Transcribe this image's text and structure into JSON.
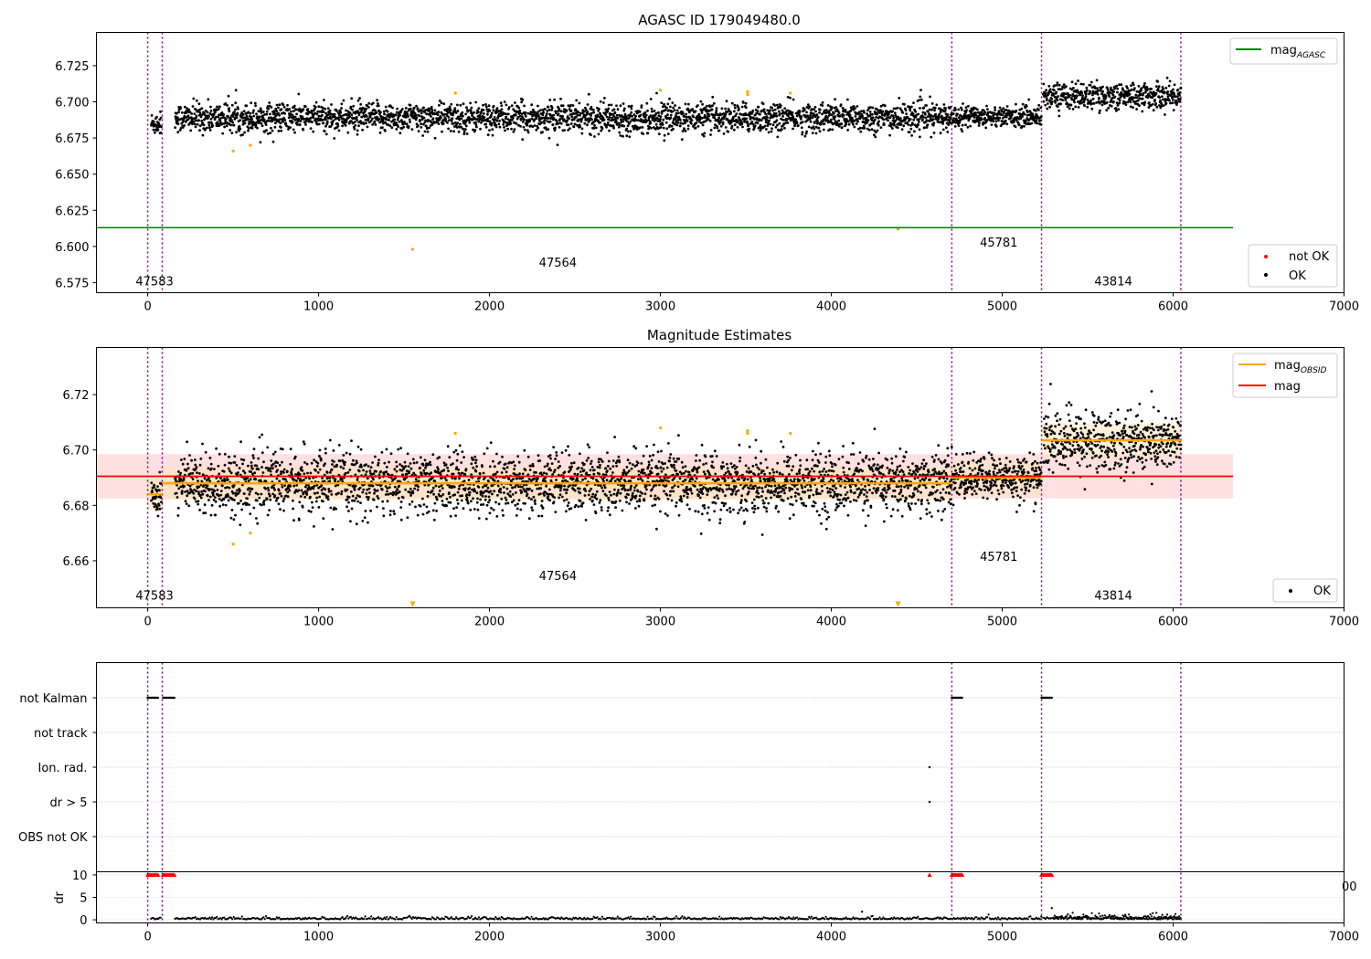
{
  "chart_data": [
    {
      "type": "scatter",
      "title": "AGASC ID 179049480.0",
      "xlim": [
        -300,
        7000
      ],
      "ylim": [
        6.568,
        6.748
      ],
      "xticks": [
        0,
        1000,
        2000,
        3000,
        4000,
        5000,
        6000,
        7000
      ],
      "yticks": [
        6.575,
        6.6,
        6.625,
        6.65,
        6.675,
        6.7,
        6.725
      ],
      "ytick_labels": [
        "6.575",
        "6.600",
        "6.625",
        "6.650",
        "6.675",
        "6.700",
        "6.725"
      ],
      "obsid_boundaries": [
        0,
        85,
        4705,
        5230,
        6045
      ],
      "obsid_labels": [
        {
          "text": "47583",
          "x": 40,
          "y": 6.573
        },
        {
          "text": "47564",
          "x": 2400,
          "y": 6.586
        },
        {
          "text": "45781",
          "x": 4980,
          "y": 6.6
        },
        {
          "text": "43814",
          "x": 5650,
          "y": 6.573
        }
      ],
      "lines": [
        {
          "name": "mag_AGASC",
          "label_main": "mag",
          "label_sub": "AGASC",
          "color": "#008000",
          "x": [
            -300,
            6350
          ],
          "y": [
            6.613,
            6.613
          ]
        }
      ],
      "segments": [
        {
          "x": [
            20,
            80
          ],
          "mean": 6.685,
          "std": 0.004
        },
        {
          "x": [
            160,
            4705
          ],
          "mean": 6.689,
          "std": 0.005
        },
        {
          "x": [
            4710,
            5230
          ],
          "mean": 6.69,
          "std": 0.0035
        },
        {
          "x": [
            5240,
            6045
          ],
          "mean": 6.704,
          "std": 0.0045
        }
      ],
      "outliers": [
        {
          "x": 500,
          "y": 6.666
        },
        {
          "x": 600,
          "y": 6.67
        },
        {
          "x": 1550,
          "y": 6.598
        },
        {
          "x": 1800,
          "y": 6.706
        },
        {
          "x": 3000,
          "y": 6.708
        },
        {
          "x": 3510,
          "y": 6.707
        },
        {
          "x": 3510,
          "y": 6.705
        },
        {
          "x": 3760,
          "y": 6.706
        },
        {
          "x": 4390,
          "y": 6.612
        }
      ],
      "legend_upper": {
        "position": "top-right"
      },
      "legend_lower": {
        "position": "bottom-right",
        "entries": [
          {
            "name": "not OK",
            "color": "#ff0000"
          },
          {
            "name": "OK",
            "color": "#000000"
          }
        ]
      }
    },
    {
      "type": "scatter",
      "title": "Magnitude Estimates",
      "xlim": [
        -300,
        7000
      ],
      "ylim": [
        6.643,
        6.737
      ],
      "xticks": [
        0,
        1000,
        2000,
        3000,
        4000,
        5000,
        6000,
        7000
      ],
      "yticks": [
        6.66,
        6.68,
        6.7,
        6.72
      ],
      "ytick_labels": [
        "6.66",
        "6.68",
        "6.70",
        "6.72"
      ],
      "obsid_boundaries": [
        0,
        85,
        4705,
        5230,
        6045
      ],
      "obsid_labels": [
        {
          "text": "47583",
          "x": 40,
          "y": 6.646
        },
        {
          "text": "47564",
          "x": 2400,
          "y": 6.653
        },
        {
          "text": "45781",
          "x": 4980,
          "y": 6.66
        },
        {
          "text": "43814",
          "x": 5650,
          "y": 6.646
        }
      ],
      "mag": {
        "value": 6.6905,
        "band": [
          6.6825,
          6.6985
        ],
        "x": [
          -300,
          6350
        ],
        "color": "#ff0000",
        "band_color": "#ffcccc"
      },
      "mag_obsid": [
        {
          "x": [
            0,
            85
          ],
          "value": 6.684
        },
        {
          "x": [
            85,
            4705
          ],
          "value": 6.688
        },
        {
          "x": [
            4705,
            5230
          ],
          "value": 6.69
        },
        {
          "x": [
            5230,
            6045
          ],
          "value": 6.7035
        }
      ],
      "mag_obsid_color": "#ffa500",
      "segments": [
        {
          "x": [
            20,
            80
          ],
          "mean": 6.684,
          "std": 0.0035
        },
        {
          "x": [
            160,
            4705
          ],
          "mean": 6.688,
          "std": 0.0055
        },
        {
          "x": [
            4710,
            5230
          ],
          "mean": 6.69,
          "std": 0.004
        },
        {
          "x": [
            5240,
            6045
          ],
          "mean": 6.703,
          "std": 0.0055
        }
      ],
      "outliers": [
        {
          "x": 500,
          "y": 6.666
        },
        {
          "x": 600,
          "y": 6.67
        },
        {
          "x": 1800,
          "y": 6.706
        },
        {
          "x": 3000,
          "y": 6.708
        },
        {
          "x": 3510,
          "y": 6.707
        },
        {
          "x": 3510,
          "y": 6.706
        },
        {
          "x": 3760,
          "y": 6.706
        }
      ],
      "below_range_markers": [
        1550,
        4390
      ],
      "legend_upper": {
        "position": "top-right",
        "entries": [
          {
            "label_main": "mag",
            "label_sub": "OBSID",
            "color": "#ffa500"
          },
          {
            "label_main": "mag",
            "label_sub": "",
            "color": "#ff0000"
          }
        ]
      },
      "legend_lower": {
        "position": "bottom-right",
        "entries": [
          {
            "name": "OK",
            "color": "#000000"
          }
        ]
      }
    },
    {
      "type": "scatter",
      "title": "",
      "xlim": [
        -300,
        7000
      ],
      "xticks": [
        0,
        1000,
        2000,
        3000,
        4000,
        5000,
        6000,
        7000
      ],
      "flag_rows": [
        "not Kalman",
        "not track",
        "Ion. rad.",
        "dr > 5",
        "OBS not OK"
      ],
      "flags": {
        "not Kalman": [
          [
            0,
            60
          ],
          [
            90,
            160
          ],
          [
            4705,
            4765
          ],
          [
            5230,
            5290
          ]
        ],
        "not track": [],
        "Ion. rad.": [
          [
            4575,
            4580
          ]
        ],
        "dr > 5": [
          [
            4575,
            4580
          ]
        ],
        "OBS not OK": []
      },
      "dr_axis": {
        "ylabel": "dr",
        "yticks": [
          0,
          5,
          10
        ],
        "ytick_labels": [
          "0",
          "5",
          "10"
        ],
        "ylim": [
          -0.7,
          10.7
        ],
        "clip_value": 10,
        "clipped_ranges": [
          [
            0,
            60
          ],
          [
            90,
            160
          ],
          [
            4705,
            4765
          ],
          [
            5230,
            5290
          ]
        ],
        "clipped_points": [
          4575
        ],
        "baseline": [
          [
            20,
            80
          ],
          [
            160,
            4705
          ],
          [
            4710,
            5230
          ],
          [
            5240,
            6045
          ]
        ],
        "extra_points": [
          {
            "x": 4180,
            "y": 1.8
          },
          {
            "x": 5290,
            "y": 2.6
          }
        ],
        "overlap_tick_text": "00"
      },
      "obsid_boundaries": [
        0,
        85,
        4705,
        5230,
        6045
      ]
    }
  ]
}
